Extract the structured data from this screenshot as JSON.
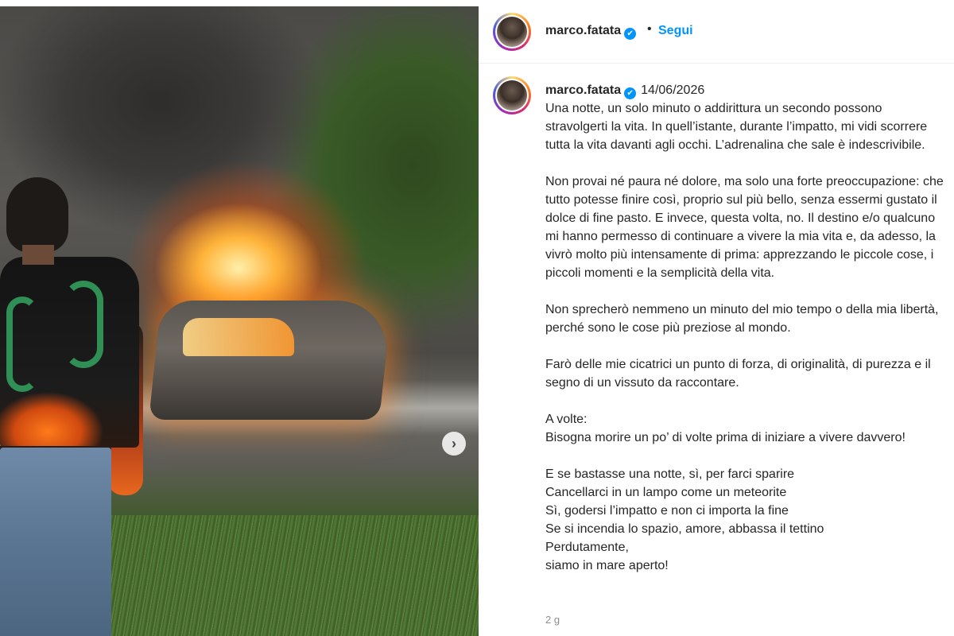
{
  "header": {
    "username": "marco.fatata",
    "verified_mark": "✔",
    "separator": "•",
    "follow_label": "Segui"
  },
  "post": {
    "username": "marco.fatata",
    "verified_mark": "✔",
    "date": "14/06/2026",
    "paragraphs": [
      [
        "Una notte, un solo minuto o addirittura un secondo possono stravolgerti la vita. In quell’istante, durante l’impatto, mi vidi scorrere tutta la vita davanti agli occhi. L’adrenalina che sale è indescrivibile."
      ],
      [
        "Non provai né paura né dolore, ma solo una forte preoccupazione: che tutto potesse finire così, proprio sul più bello, senza essermi gustato il dolce di fine pasto. E invece, questa volta, no. Il destino e/o qualcuno mi hanno permesso di continuare a vivere la mia vita e, da adesso, la vivrò molto più intensamente di prima: apprezzando le piccole cose, i piccoli momenti e la semplicità della vita."
      ],
      [
        "Non sprecherò nemmeno un minuto del mio tempo o della mia libertà, perché sono le cose più preziose al mondo."
      ],
      [
        "Farò delle mie cicatrici un punto di forza, di originalità, di purezza e il segno di un vissuto da raccontare."
      ],
      [
        "A volte:",
        "Bisogna morire un po’ di volte prima di iniziare a vivere davvero!"
      ],
      [
        "E se bastasse una notte, sì, per farci sparire",
        "Cancellarci in un lampo come un meteorite",
        "Sì, godersi l’impatto e non ci importa la fine",
        "Se si incendia lo spazio, amore, abbassa il tettino",
        "Perdutamente,",
        "siamo in mare aperto!"
      ]
    ],
    "time_ago": "2 g"
  },
  "photo": {
    "next_icon": "›"
  },
  "colors": {
    "accent": "#0095f6",
    "text": "#262626",
    "muted": "#8e8e8e"
  }
}
